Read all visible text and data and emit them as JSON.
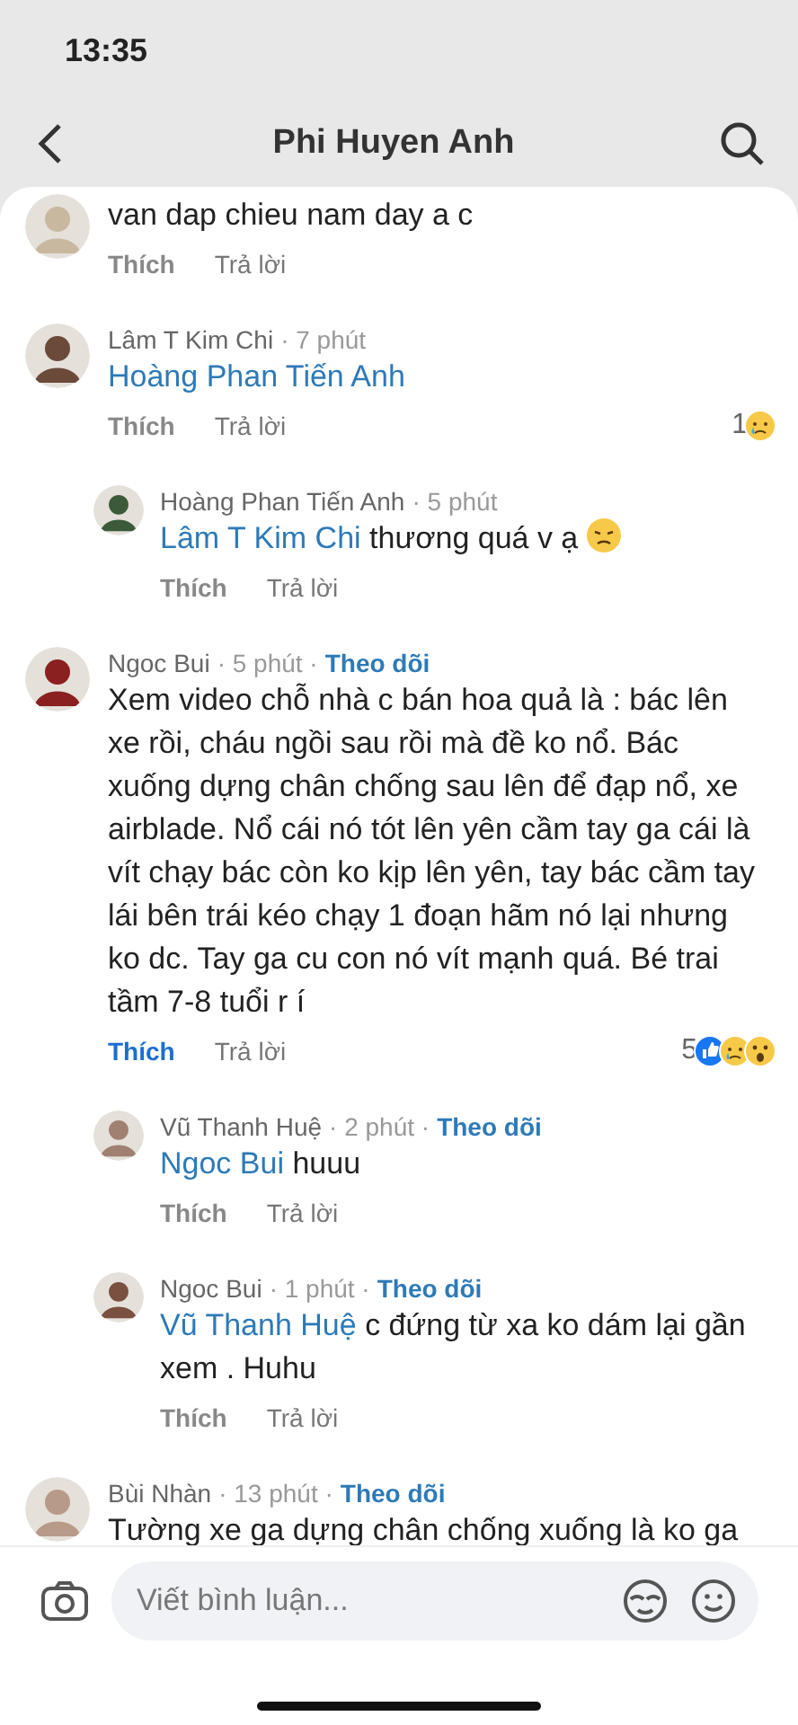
{
  "status_bar": {
    "time": "13:35"
  },
  "header": {
    "title": "Phi Huyen Anh"
  },
  "comments": [
    {
      "body": "van dap chieu nam day a c",
      "liked": false,
      "like_label": "Thích",
      "reply_label": "Trả lời"
    },
    {
      "author": "Lâm T Kim Chi",
      "time": "· 7 phút",
      "mention": "Hoàng Phan Tiến Anh",
      "liked": false,
      "like_label": "Thích",
      "reply_label": "Trả lời",
      "reaction_count": "1",
      "reactions": [
        {
          "kind": "sad"
        }
      ],
      "children": [
        {
          "author": "Hoàng Phan Tiến Anh",
          "time": "· 5 phút",
          "mention": "Lâm T Kim Chi",
          "body": "thương quá v ạ",
          "emoji": {
            "kind": "disappointed"
          },
          "liked": false,
          "like_label": "Thích",
          "reply_label": "Trả lời"
        }
      ]
    },
    {
      "author": "Ngoc Bui",
      "time": "· 5 phút ·",
      "follow": "Theo dõi",
      "body": "Xem video chỗ nhà c bán hoa quả là : bác lên xe rồi, cháu ngồi sau rồi mà đề ko nổ. Bác xuống dựng chân chống sau lên để đạp nổ, xe airblade. Nổ cái nó tót lên yên cầm tay ga cái là vít chạy bác còn ko kịp lên yên, tay bác cầm tay lái bên trái kéo chạy 1 đoạn hãm nó lại nhưng ko dc. Tay ga cu con nó vít mạnh quá. Bé trai tầm 7-8 tuổi r í",
      "liked": true,
      "like_label": "Thích",
      "reply_label": "Trả lời",
      "reaction_count": "5",
      "reactions": [
        {
          "kind": "like"
        },
        {
          "kind": "sad"
        },
        {
          "kind": "wow"
        }
      ],
      "children": [
        {
          "author": "Vũ Thanh Huệ",
          "time": "· 2 phút ·",
          "follow": "Theo dõi",
          "mention": "Ngoc Bui",
          "body": "huuu",
          "liked": false,
          "like_label": "Thích",
          "reply_label": "Trả lời"
        },
        {
          "author": "Ngoc Bui",
          "time": "· 1 phút ·",
          "follow": "Theo dõi",
          "mention": "Vũ Thanh Huệ",
          "body": "c đứng từ xa ko dám lại gần xem . Huhu",
          "liked": false,
          "like_label": "Thích",
          "reply_label": "Trả lời"
        }
      ]
    },
    {
      "author": "Bùi Nhàn",
      "time": "· 13 phút ·",
      "follow": "Theo dõi",
      "body": "Tường xe ga dựng chân chống xuống là ko ga"
    }
  ],
  "composer": {
    "placeholder": "Viết bình luận..."
  }
}
